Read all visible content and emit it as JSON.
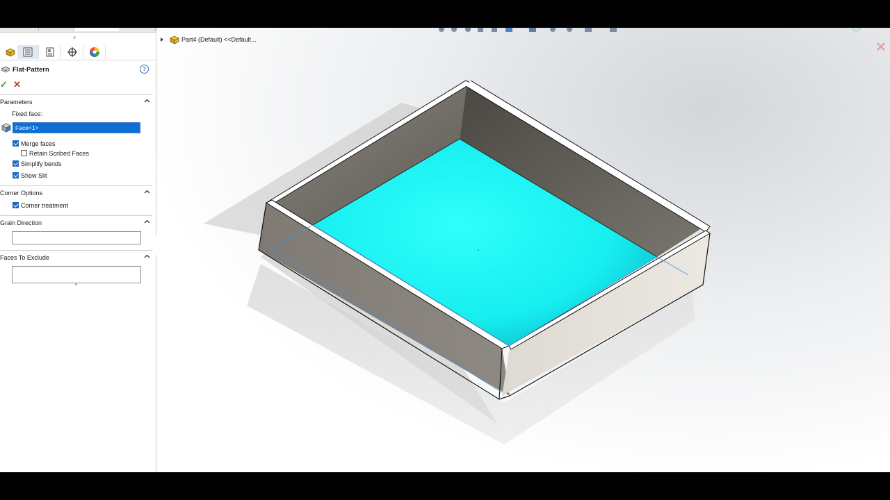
{
  "property_manager": {
    "feature_title": "Flat-Pattern",
    "sections": {
      "parameters": "Parameters",
      "corner_options": "Corner Options",
      "grain_direction": "Grain Direction",
      "faces_to_exclude": "Faces To Exclude"
    },
    "fixed_face_label": "Fixed face:",
    "fixed_face_value": "Face<1>",
    "options": {
      "merge_faces": {
        "label": "Merge faces",
        "checked": true
      },
      "retain_scribed_faces": {
        "label": "Retain Scribed Faces",
        "checked": false
      },
      "simplify_bends": {
        "label": "Simplify bends",
        "checked": true
      },
      "show_slit": {
        "label": "Show Slit",
        "checked": true
      },
      "corner_treatment": {
        "label": "Corner treatment",
        "checked": true
      }
    },
    "grain_direction_value": "",
    "faces_to_exclude_value": ""
  },
  "feature_tree": {
    "root_label": "Part4 (Default) <<Default..."
  },
  "icons": {
    "tabs": [
      "feature-manager-icon",
      "property-manager-icon",
      "configuration-manager-icon",
      "dimxpert-icon",
      "display-manager-icon"
    ],
    "flat_pattern": "flat-pattern-icon",
    "help": "help-icon",
    "ok": "ok-checkmark-icon",
    "cancel": "cancel-x-icon",
    "face_selector": "face-selection-icon"
  },
  "colors": {
    "selected_face": "#1ff4f0",
    "selection_blue": "#0d6fd6",
    "ok_green": "#2f9a2f",
    "cancel_red": "#c0392b",
    "model_gray": "#8c8780"
  }
}
